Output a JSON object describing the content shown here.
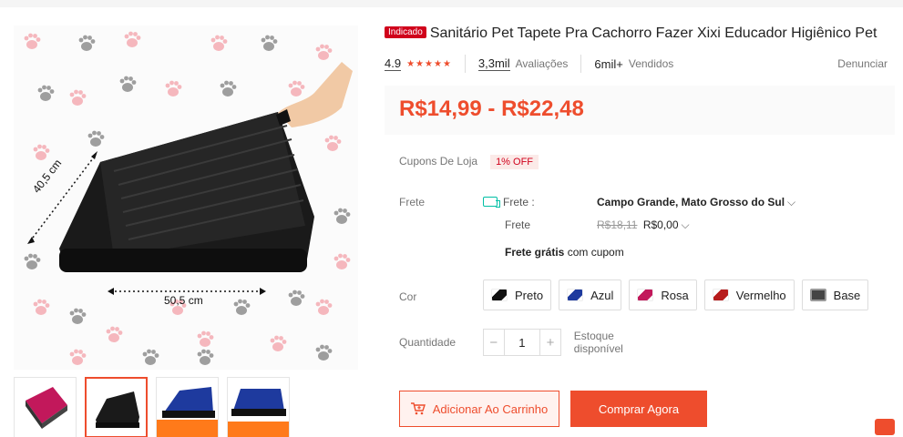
{
  "product": {
    "badge": "Indicado",
    "title": "Sanitário Pet Tapete Pra Cachorro Fazer Xixi Educador Higiênico Pet",
    "rating": "4.9",
    "stars": "★★★★★",
    "reviews_count": "3,3mil",
    "reviews_label": "Avaliações",
    "sold_count": "6mil+",
    "sold_label": "Vendidos",
    "report_label": "Denunciar",
    "price": "R$14,99 - R$22,48"
  },
  "image": {
    "dim_width": "50,5 cm",
    "dim_depth": "40,5 cm"
  },
  "coupons": {
    "label": "Cupons De Loja",
    "value": "1% OFF"
  },
  "shipping": {
    "label": "Frete",
    "to_label": "Frete :",
    "destination": "Campo Grande, Mato Grosso do Sul",
    "cost_label": "Frete",
    "old_price": "R$18,11",
    "new_price": "R$0,00",
    "free_bold": "Frete grátis",
    "free_rest": "com cupom"
  },
  "color": {
    "label": "Cor",
    "options": [
      "Preto",
      "Azul",
      "Rosa",
      "Vermelho",
      "Base"
    ],
    "swatches": [
      "#111111",
      "#1e3a9e",
      "#c2185b",
      "#b71c1c",
      "#444444"
    ]
  },
  "quantity": {
    "label": "Quantidade",
    "minus": "−",
    "value": "1",
    "plus": "+",
    "stock": "Estoque disponível"
  },
  "actions": {
    "add_to_cart": "Adicionar Ao Carrinho",
    "buy_now": "Comprar Agora"
  },
  "colors": {
    "accent": "#ee4d2d",
    "badge": "#d0011b",
    "ship": "#00bfa5"
  }
}
